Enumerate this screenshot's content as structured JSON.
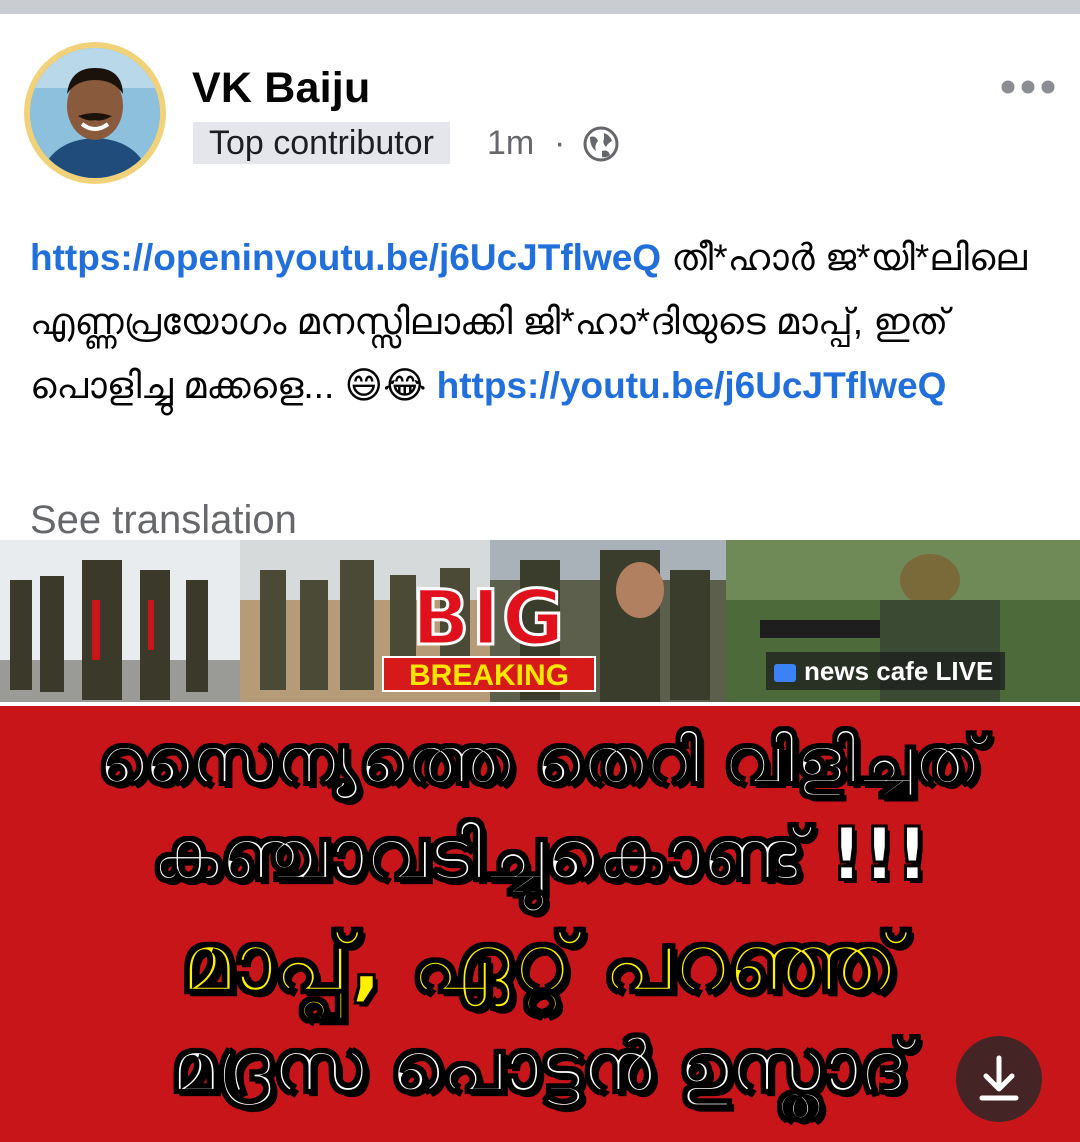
{
  "post": {
    "author_name": "VK Baiju",
    "badge": "Top contributor",
    "time": "1m",
    "separator": "·",
    "privacy_icon": "globe-icon",
    "more_icon": "more-horizontal-icon",
    "link1": "https://openinyoutu.be/j6UcJTflweQ",
    "text_part1": " തീ*ഹാർ ജ*യി*ലിലെ എണ്ണപ്രയോഗം മനസ്സിലാക്കി ജി*ഹാ*ദിയുടെ മാപ്പ്, ഇത് പൊളിച്ചു മക്കളെ... ",
    "emoji1": "😄",
    "emoji2": "😂",
    "link2": "https://youtu.be/j6UcJTflweQ",
    "see_translation": "See translation"
  },
  "thumbnail": {
    "big_word": "BIG",
    "breaking": "BREAKING",
    "channel": "news cafe LIVE",
    "line1": "സൈന്യത്തെ തെറി വിളിച്ചത്",
    "line2": "കഞ്ചാവടിച്ചുകൊണ്ട് !!!",
    "line3": "മാപ്പ്, ഏറ്റ് പറഞ്ഞ്",
    "line4": "മദ്രസ പൊട്ടൻ ഉസ്താദ്",
    "download_icon": "download-icon",
    "colors": {
      "panel": "#c8151a",
      "headline_white": "#ffffff",
      "headline_yellow": "#fff000"
    }
  },
  "colors": {
    "link": "#216fdb",
    "secondary_text": "#65676b",
    "badge_bg": "#e4e6eb"
  }
}
